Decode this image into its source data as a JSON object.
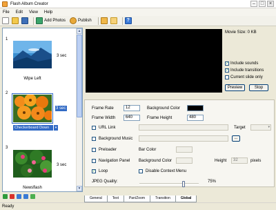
{
  "window": {
    "title": "Flash Album Creator"
  },
  "menu": [
    "File",
    "Edit",
    "View",
    "Help"
  ],
  "toolbar": {
    "add_photos": "Add Photos",
    "publish": "Publish"
  },
  "slides": [
    {
      "number": "1",
      "duration": "3 sec",
      "transition": "Wipe Left"
    },
    {
      "number": "2",
      "duration": "3 sec",
      "transition": "Checkerboard Down"
    },
    {
      "number": "3",
      "duration": "3 sec",
      "transition": "Newsflash"
    }
  ],
  "preview": {
    "movie_size": "Movie Size: 0 KB",
    "include_sounds": "Include sounds",
    "include_transitions": "Include transitions",
    "current_slide_only": "Current slide only",
    "preview_btn": "Preview",
    "stop_btn": "Stop"
  },
  "global": {
    "frame_rate_label": "Frame Rate",
    "frame_rate": "12",
    "frame_width_label": "Frame Width",
    "frame_width": "640",
    "frame_height_label": "Frame Height",
    "frame_height": "480",
    "background_color_label": "Background Color",
    "url_link": "URL Link",
    "target_label": "Target",
    "background_music": "Background Music",
    "preloader": "Preloader",
    "bar_color": "Bar Color",
    "navigation_panel": "Navigation Panel",
    "nav_background_color": "Background Color",
    "height_label": "Height",
    "height_value": "32",
    "pixels": "pixels",
    "loop": "Loop",
    "disable_context_menu": "Disable Context Menu",
    "jpeg_quality_label": "JPEG Quality:",
    "jpeg_quality": "75%",
    "jpeg_quality_fraction": 0.75,
    "browse": "..."
  },
  "tabs": [
    "General",
    "Text",
    "Pan/Zoom",
    "Transition",
    "Global"
  ],
  "status": "Ready",
  "colors": {
    "selection": "#316ac5",
    "preview_bg": "#000000"
  }
}
